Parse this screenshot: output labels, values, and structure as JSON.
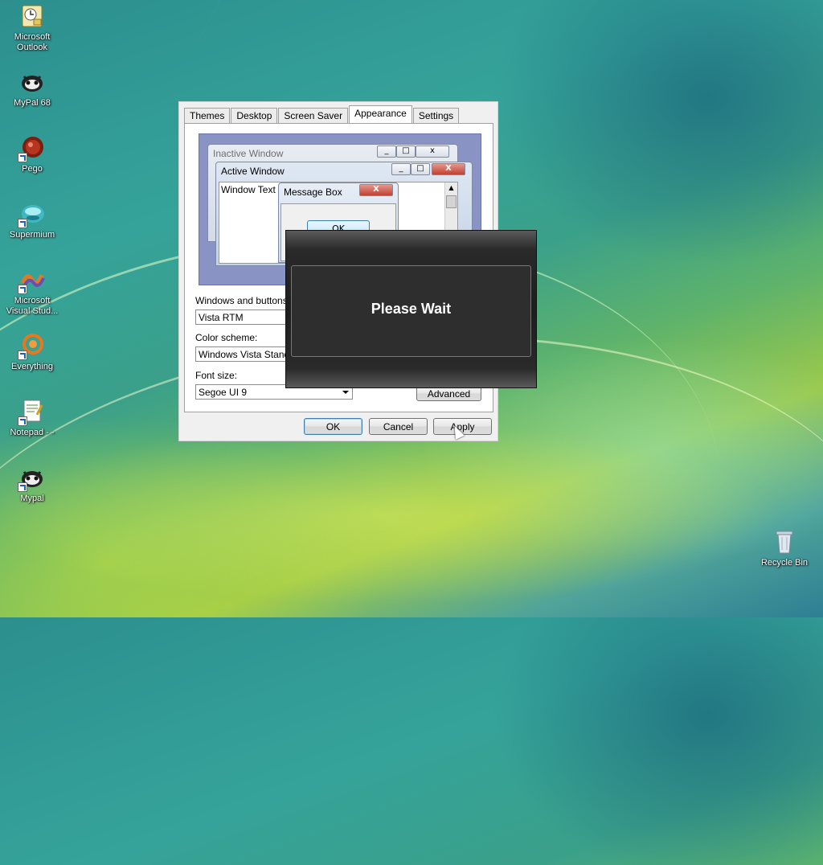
{
  "desktop": {
    "icons": [
      {
        "label": "Microsoft Outlook",
        "icon": "outlook-icon"
      },
      {
        "label": "MyPal 68",
        "icon": "mypal-icon"
      },
      {
        "label": "Pego",
        "icon": "pego-icon"
      },
      {
        "label": "Supermium",
        "icon": "supermium-icon"
      },
      {
        "label": "Microsoft Visual Stud...",
        "icon": "visual-studio-icon"
      },
      {
        "label": "Everything",
        "icon": "everything-icon"
      },
      {
        "label": "Notepad - -",
        "icon": "notepad-icon"
      },
      {
        "label": "Mypal",
        "icon": "mypal-icon"
      },
      {
        "label": "Recycle Bin",
        "icon": "recycle-bin-icon"
      }
    ]
  },
  "dialog": {
    "tabs": [
      {
        "label": "Themes"
      },
      {
        "label": "Desktop"
      },
      {
        "label": "Screen Saver"
      },
      {
        "label": "Appearance",
        "active": true
      },
      {
        "label": "Settings"
      }
    ],
    "preview": {
      "inactive_title": "Inactive Window",
      "active_title": "Active Window",
      "window_text": "Window Text",
      "message_box_title": "Message Box",
      "message_box_ok": "OK",
      "close_glyph": "X"
    },
    "windows_and_buttons": {
      "label": "Windows and buttons:",
      "value": "Vista RTM"
    },
    "color_scheme": {
      "label": "Color scheme:",
      "value": "Windows Vista Standard"
    },
    "font_size": {
      "label": "Font size:",
      "value": "Segoe UI 9"
    },
    "advanced_label": "Advanced",
    "ok_label": "OK",
    "cancel_label": "Cancel",
    "apply_label": "Apply"
  },
  "overlay": {
    "message": "Please Wait"
  },
  "colors": {
    "preview_bg": "#8993c4",
    "overlay_bg": "#1d1d1d",
    "desktop_accent": "#35a39a"
  }
}
